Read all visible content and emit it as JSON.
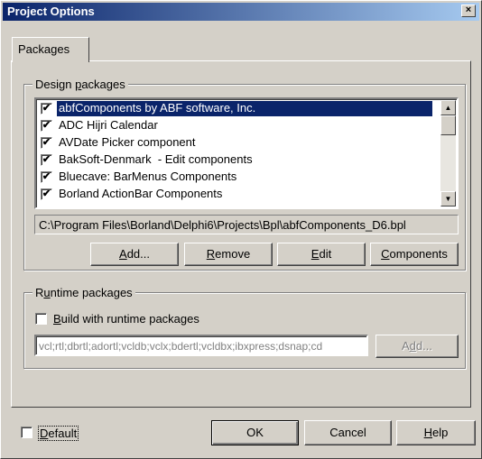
{
  "window": {
    "title": "Project Options",
    "close_glyph": "×"
  },
  "tabs": [
    {
      "label": "Packages"
    }
  ],
  "design_packages": {
    "group_label": "Design packages",
    "items": [
      {
        "label": "abfComponents by ABF software, Inc.",
        "checked": true,
        "selected": true
      },
      {
        "label": "ADC Hijri Calendar",
        "checked": true
      },
      {
        "label": "AVDate Picker component",
        "checked": true
      },
      {
        "label": "BakSoft-Denmark  - Edit components",
        "checked": true
      },
      {
        "label": "Bluecave: BarMenus Components",
        "checked": true
      },
      {
        "label": "Borland ActionBar Components",
        "checked": true
      }
    ],
    "check_glyph": "✔",
    "path": "C:\\Program Files\\Borland\\Delphi6\\Projects\\Bpl\\abfComponents_D6.bpl",
    "buttons": {
      "add": "Add...",
      "remove": "Remove",
      "edit": "Edit",
      "components": "Components"
    }
  },
  "runtime_packages": {
    "group_label": "Runtime packages",
    "build_label": "Build with runtime packages",
    "build_checked": false,
    "packages_value": "vcl;rtl;dbrtl;adortl;vcldb;vclx;bdertl;vcldbx;ibxpress;dsnap;cd",
    "add_button": "Add..."
  },
  "footer": {
    "default_label": "Default",
    "default_checked": false,
    "ok": "OK",
    "cancel": "Cancel",
    "help": "Help"
  },
  "colors": {
    "title_start": "#0a246a",
    "title_end": "#a6caf0",
    "face": "#d4d0c8",
    "selection": "#0a246a"
  }
}
